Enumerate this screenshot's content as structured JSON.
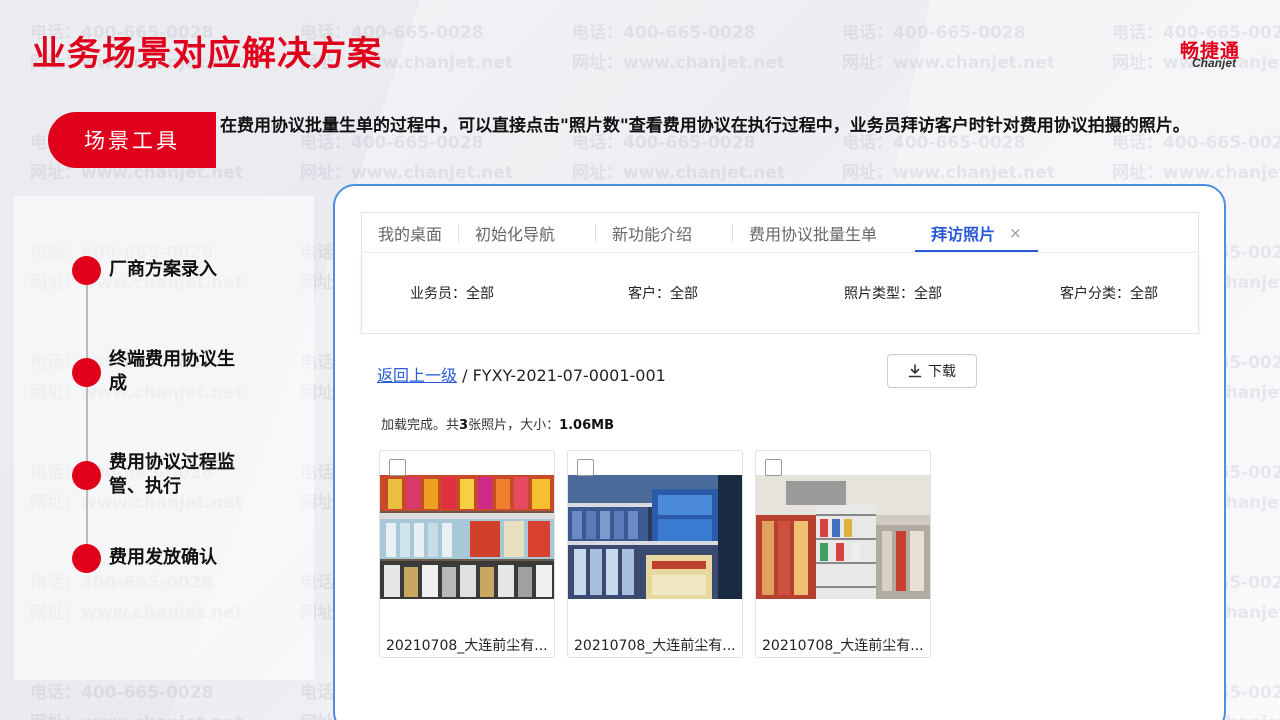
{
  "slide": {
    "title": "业务场景对应解决方案",
    "brand_cn": "畅捷通",
    "brand_en": "Chanjet",
    "scene_tag": "场景工具",
    "scene_description": "在费用协议批量生单的过程中，可以直接点击\"照片数\"查看费用协议在执行过程中，业务员拜访客户时针对费用协议拍摄的照片。",
    "watermark_phone": "电话：400-665-0028",
    "watermark_site": "网址：www.chanjet.net",
    "accent_color": "#e0001b"
  },
  "timeline": [
    {
      "label": "厂商方案录入"
    },
    {
      "label": "终端费用协议生成"
    },
    {
      "label": "费用协议过程监管、执行"
    },
    {
      "label": "费用发放确认"
    }
  ],
  "app": {
    "tabs": [
      {
        "label": "我的桌面"
      },
      {
        "label": "初始化导航"
      },
      {
        "label": "新功能介绍"
      },
      {
        "label": "费用协议批量生单"
      },
      {
        "label": "拜访照片"
      }
    ],
    "tab_close_icon": "×",
    "filters": [
      {
        "label": "业务员：全部"
      },
      {
        "label": "客户：全部"
      },
      {
        "label": "照片类型：全部"
      },
      {
        "label": "客户分类：全部"
      }
    ],
    "breadcrumb": {
      "back_link": "返回上一级",
      "separator": "/",
      "current": "FYXY-2021-07-0001-001"
    },
    "download_label": "下载",
    "load_status": {
      "prefix": "加载完成。共",
      "count": "3",
      "middle": "张照片，大小：",
      "size": "1.06MB"
    },
    "photos": [
      {
        "caption": "20210708_大连前尘有..."
      },
      {
        "caption": "20210708_大连前尘有..."
      },
      {
        "caption": "20210708_大连前尘有..."
      }
    ]
  }
}
